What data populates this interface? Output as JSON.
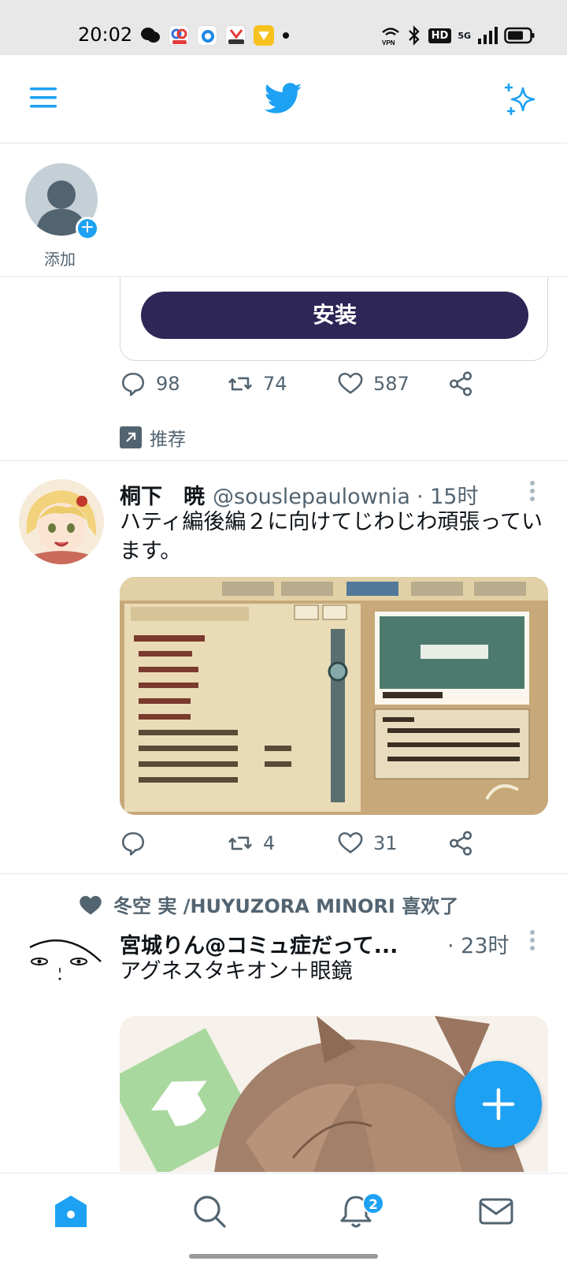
{
  "status_bar": {
    "time": "20:02",
    "network": "5G",
    "hd_label": "HD",
    "vpn_label": "VPN"
  },
  "fleets": {
    "add_label": "添加"
  },
  "ad": {
    "install_label": "安装",
    "stats": {
      "replies": "98",
      "retweets": "74",
      "likes": "587"
    },
    "promoted_label": "推荐"
  },
  "tweets": [
    {
      "name": "桐下　暁",
      "handle": "@souslepaulownia",
      "time": "· 15时",
      "text": "ハティ編後編２に向けてじわじわ頑張っています。",
      "stats": {
        "replies": "",
        "retweets": "4",
        "likes": "31"
      }
    },
    {
      "liked_by": "冬空 実 /HUYUZORA MINORI 喜欢了",
      "name": "宮城りん@コミュ症だって...",
      "time": "· 23时",
      "text": "アグネスタキオン＋眼鏡"
    }
  ],
  "bottom_nav": {
    "notification_count": "2"
  },
  "colors": {
    "accent": "#1da1f2",
    "install_button": "#2d2657",
    "secondary_text": "#536471"
  }
}
